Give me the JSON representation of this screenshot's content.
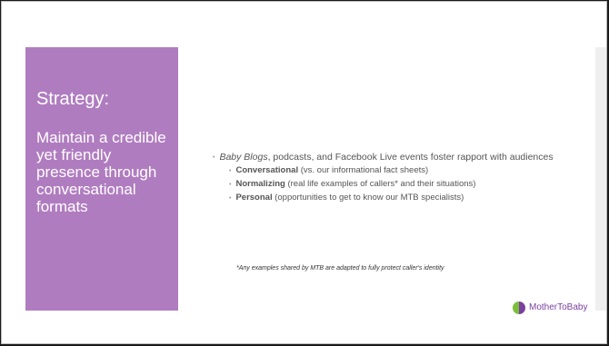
{
  "title": "Strategy:",
  "body": "Maintain a credible yet friendly presence through conversational formats",
  "bullet_italic": "Baby Blogs",
  "bullet_rest": ", podcasts, and Facebook Live events foster rapport with audiences",
  "sub": [
    {
      "bold": "Conversational",
      "rest": " (vs. our informational fact sheets)"
    },
    {
      "bold": "Normalizing",
      "rest": " (real life examples of callers* and their situations)"
    },
    {
      "bold": "Personal",
      "rest": " (opportunities to get to know our MTB specialists)"
    }
  ],
  "note": "*Any examples shared by MTB are adapted to fully protect caller's identity",
  "logo": "MotherToBaby",
  "bullet_icon": "bullet-dot-icon",
  "colors": {
    "panel": "#b07cc0"
  }
}
